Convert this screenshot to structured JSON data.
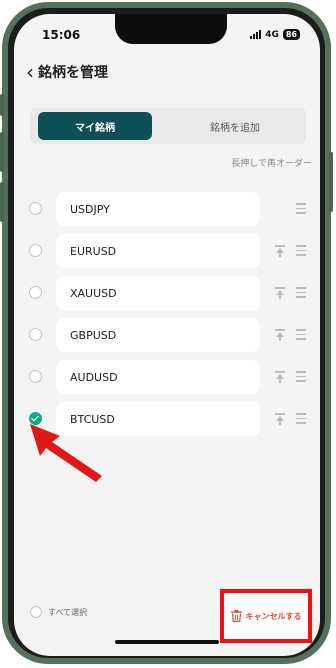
{
  "status_bar": {
    "time": "15:06",
    "network": "4G",
    "battery": "86"
  },
  "header": {
    "back_icon": "‹",
    "title": "銘柄を管理"
  },
  "tabs": [
    {
      "label": "マイ銘柄",
      "active": true
    },
    {
      "label": "銘柄を追加",
      "active": false
    }
  ],
  "hint": "長押しで再オーダー",
  "symbols": [
    {
      "name": "USDJPY",
      "checked": false,
      "pin": false
    },
    {
      "name": "EURUSD",
      "checked": false,
      "pin": true
    },
    {
      "name": "XAUUSD",
      "checked": false,
      "pin": true
    },
    {
      "name": "GBPUSD",
      "checked": false,
      "pin": true
    },
    {
      "name": "AUDUSD",
      "checked": false,
      "pin": true
    },
    {
      "name": "BTCUSD",
      "checked": true,
      "pin": true
    }
  ],
  "footer": {
    "select_all": "すべて選択",
    "cancel": "キャンセルする"
  },
  "colors": {
    "accent": "#0f4f58",
    "check": "#18a58c",
    "highlight": "#ee1313",
    "cancel_text": "#e04a2d"
  }
}
